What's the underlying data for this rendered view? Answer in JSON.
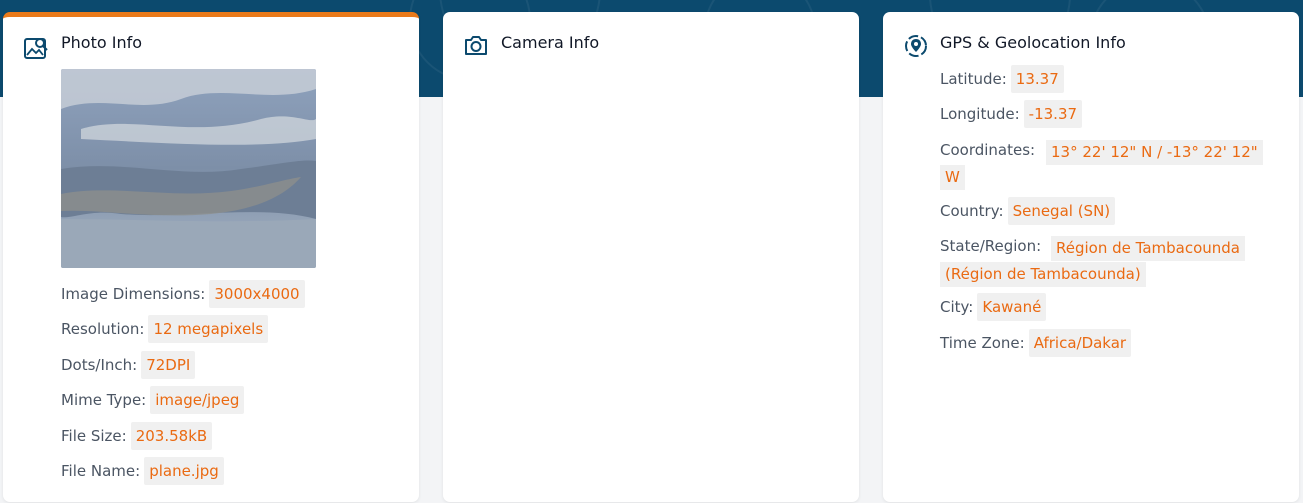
{
  "colors": {
    "accent": "#ea7a1a",
    "value_text": "#ea6a12",
    "banner": "#0c4a6e"
  },
  "photo": {
    "title": "Photo Info",
    "icon": "photo-search-icon",
    "rows": [
      {
        "label": "Image Dimensions:",
        "value": "3000x4000"
      },
      {
        "label": "Resolution:",
        "value": "12 megapixels"
      },
      {
        "label": "Dots/Inch:",
        "value": "72DPI"
      },
      {
        "label": "Mime Type:",
        "value": "image/jpeg"
      },
      {
        "label": "File Size:",
        "value": "203.58kB"
      },
      {
        "label": "File Name:",
        "value": "plane.jpg"
      }
    ]
  },
  "camera": {
    "title": "Camera Info",
    "icon": "camera-icon"
  },
  "gps": {
    "title": "GPS & Geolocation Info",
    "icon": "location-pin-icon",
    "rows": [
      {
        "label": "Latitude:",
        "value": "13.37"
      },
      {
        "label": "Longitude:",
        "value": "-13.37"
      },
      {
        "label": "Coordinates:",
        "value_line1": "13° 22' 12\" N / -13° 22' 12\"",
        "value_line2": "W"
      },
      {
        "label": "Country:",
        "value": "Senegal (SN)"
      },
      {
        "label": "State/Region:",
        "value_line1": "Région de Tambacounda",
        "value_line2": "(Région de Tambacounda)"
      },
      {
        "label": "City:",
        "value": "Kawané"
      },
      {
        "label": "Time Zone:",
        "value": "Africa/Dakar"
      }
    ]
  }
}
